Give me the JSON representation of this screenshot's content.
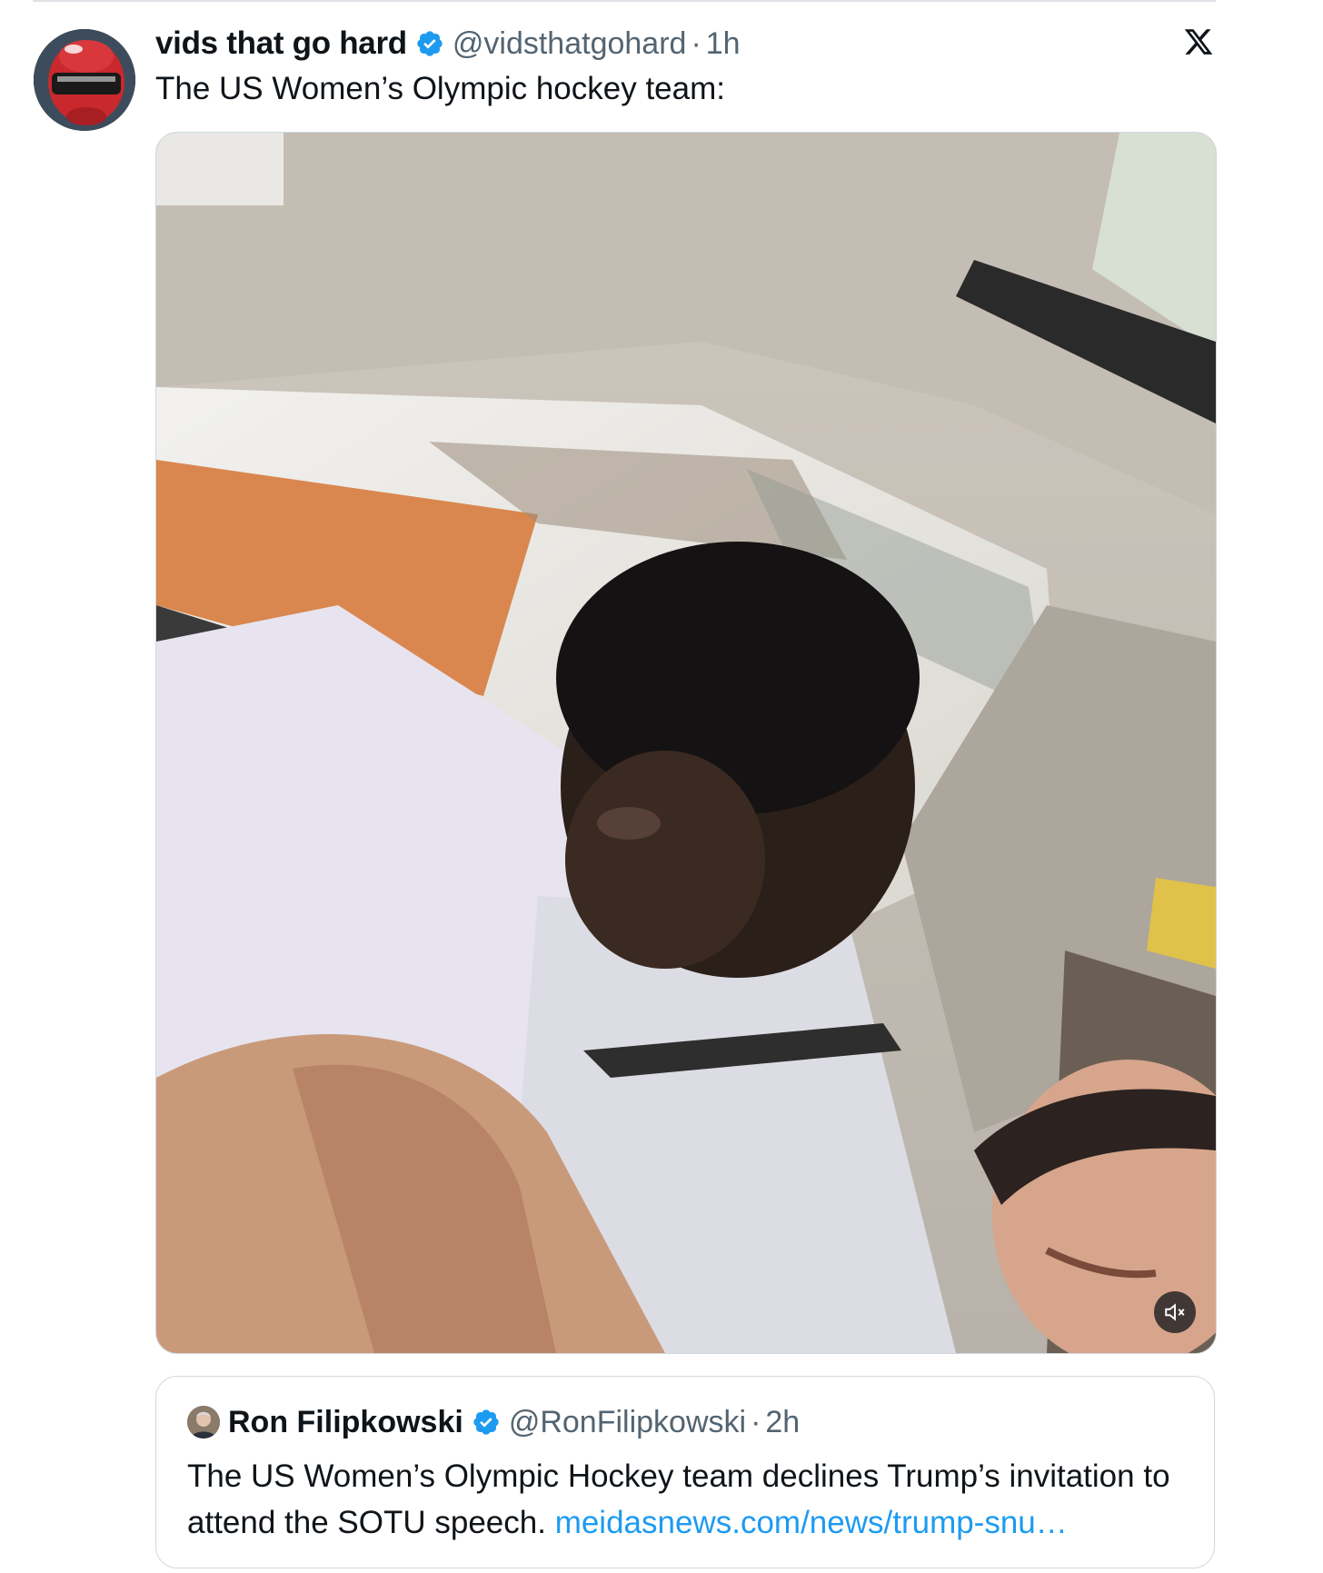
{
  "tweet": {
    "display_name": "vids that go hard",
    "handle": "@vidsthatgohard",
    "separator": "·",
    "time": "1h",
    "text": "The US Women’s Olympic hockey team:",
    "verified_icon": "verified-badge-icon",
    "platform_icon": "x-logo-icon"
  },
  "media": {
    "type": "video",
    "mute_icon": "speaker-muted-icon"
  },
  "quote": {
    "display_name": "Ron Filipkowski",
    "handle": "@RonFilipkowski",
    "separator": "·",
    "time": "2h",
    "text": "The US Women’s Olympic Hockey team declines Trump’s invitation to attend the SOTU speech.",
    "link": "meidasnews.com/news/trump-snu…"
  },
  "colors": {
    "verified": "#1d9bf0",
    "link": "#1d9bf0",
    "secondary_text": "#536471",
    "border": "#cfd9de"
  }
}
